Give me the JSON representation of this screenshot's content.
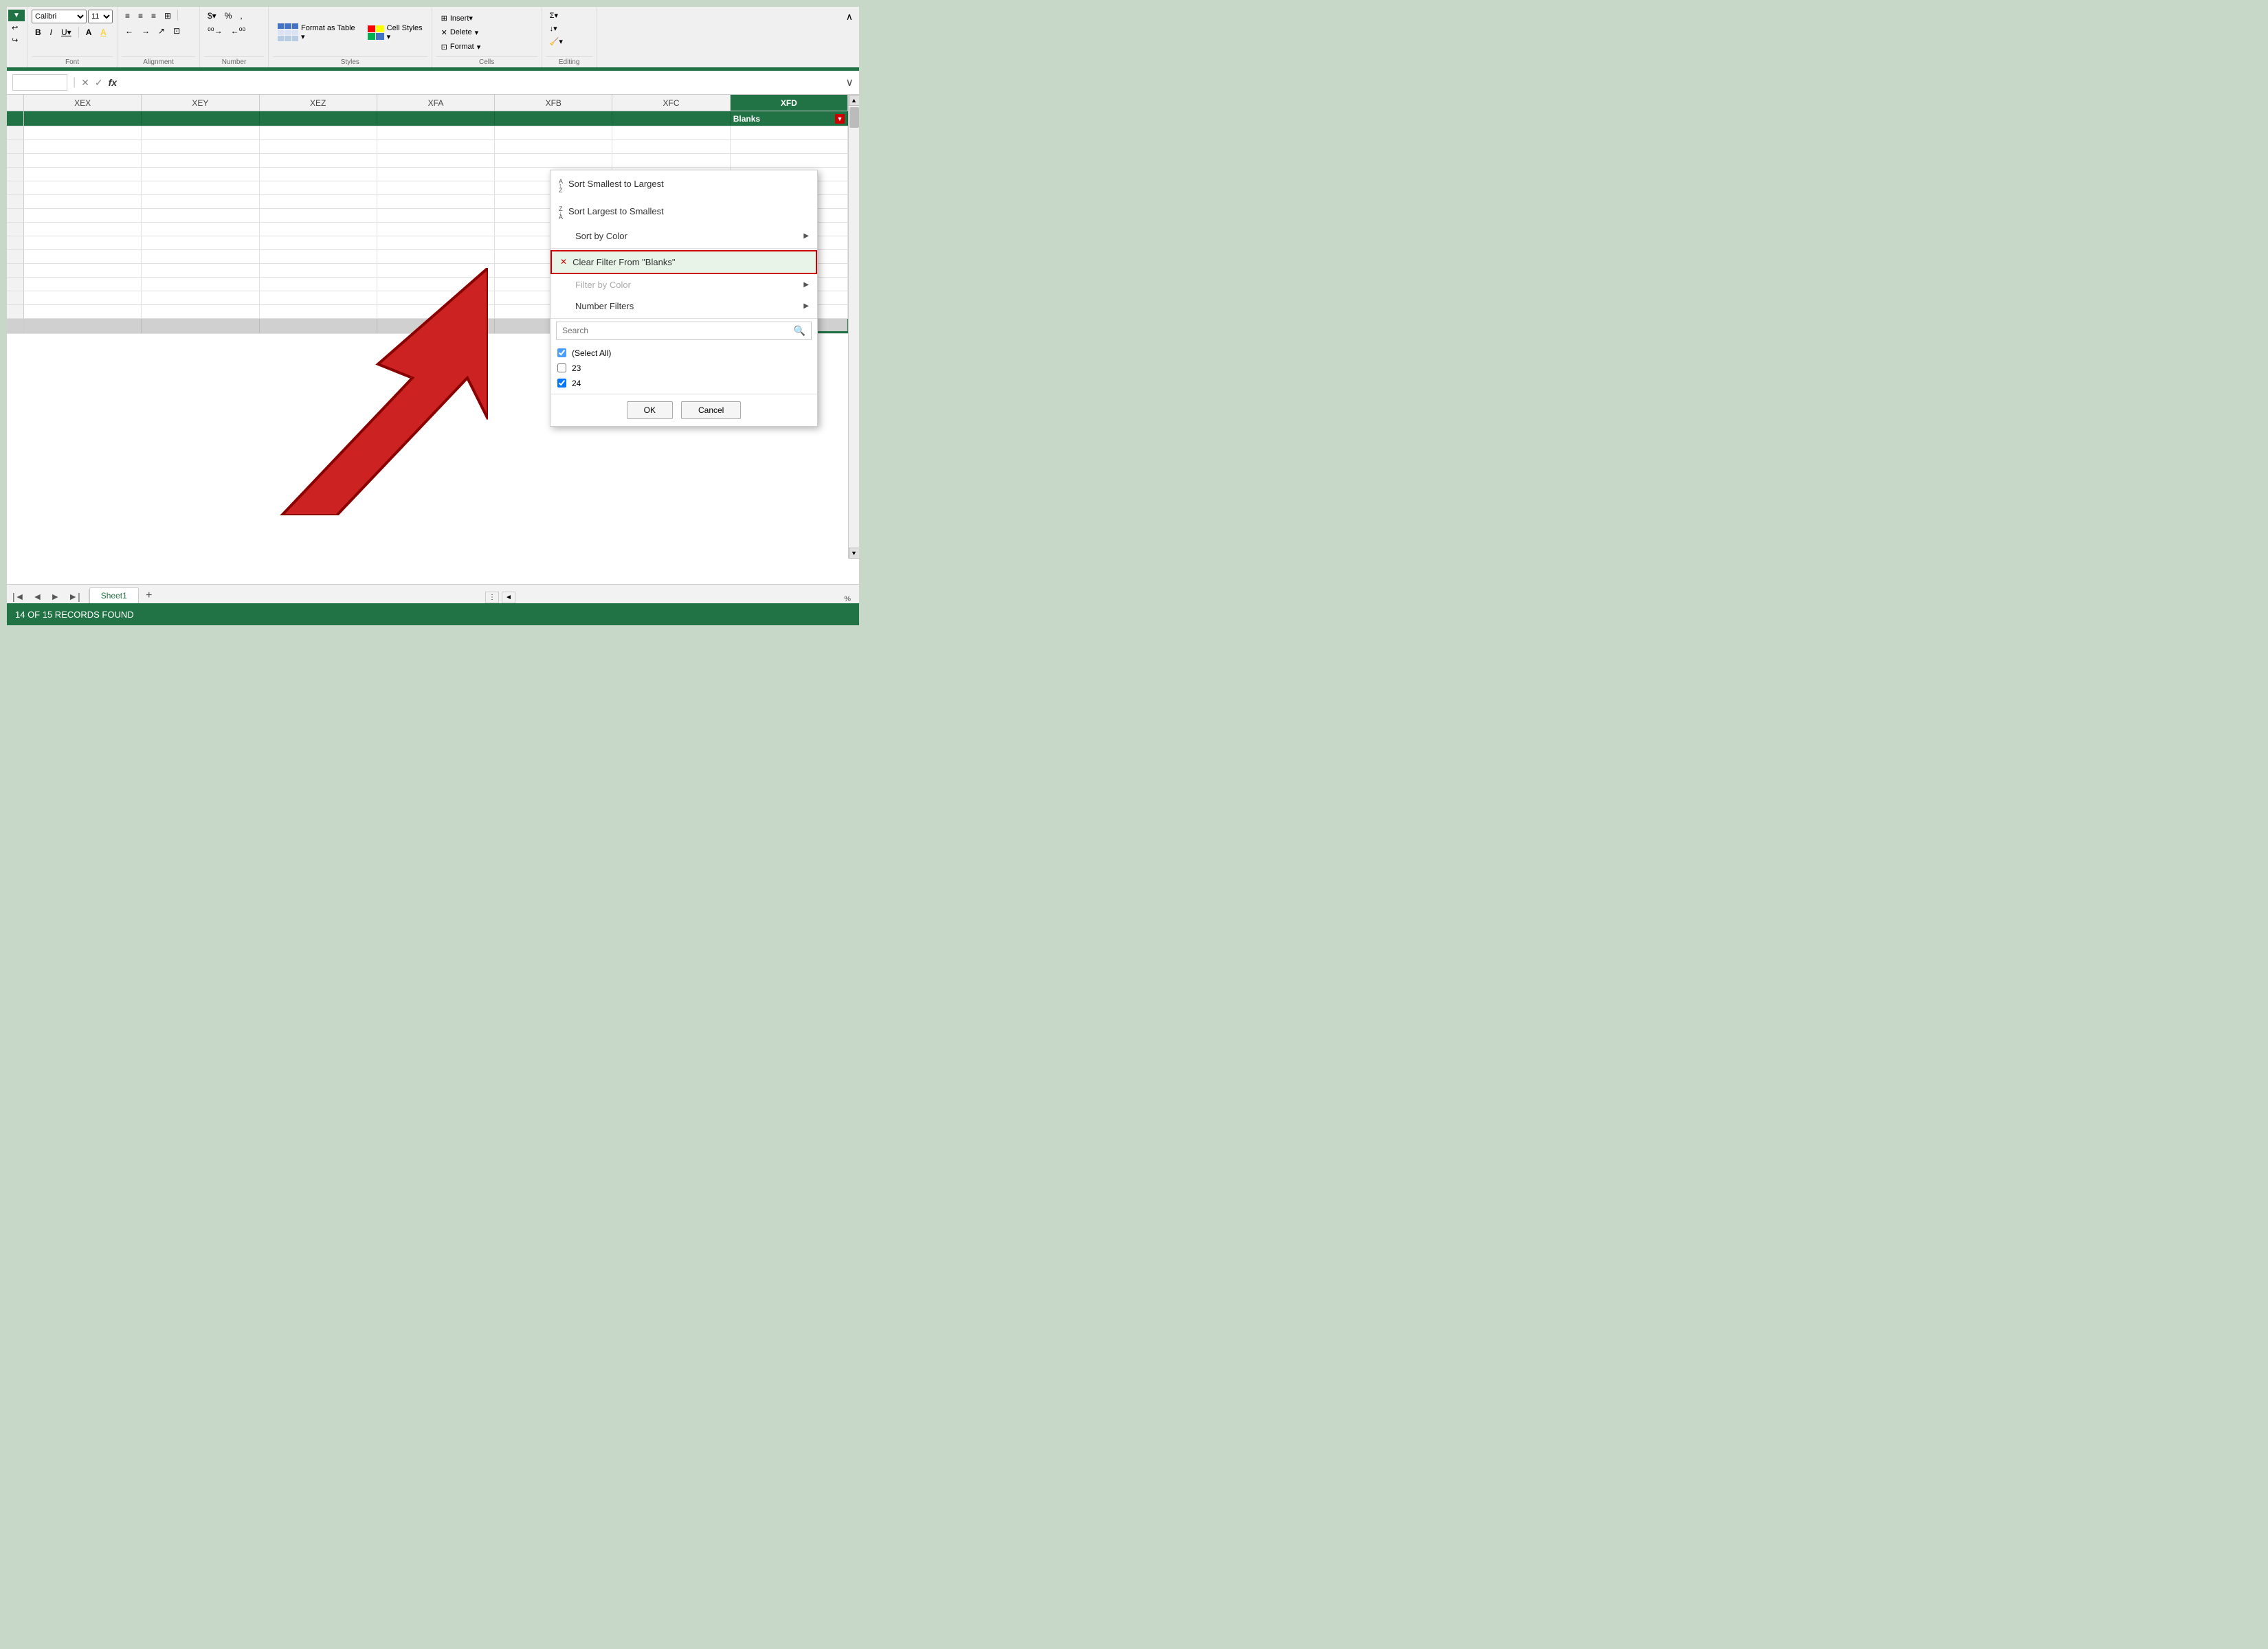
{
  "ribbon": {
    "sections": [
      {
        "name": "Font",
        "label": "Font",
        "buttons": [
          "B",
          "I",
          "U",
          "A",
          "A"
        ]
      },
      {
        "name": "Alignment",
        "label": "Alignment"
      },
      {
        "name": "Number",
        "label": "Number"
      },
      {
        "name": "Styles",
        "label": "Styles",
        "format_as_table": "Format as Table",
        "cell_styles": "Cell Styles"
      },
      {
        "name": "Cells",
        "label": "Cells",
        "delete": "Delete",
        "format": "Format"
      },
      {
        "name": "Editing",
        "label": "Editing"
      }
    ]
  },
  "formula_bar": {
    "name_box_value": "",
    "formula_value": ""
  },
  "columns": [
    "XEX",
    "XEY",
    "XEZ",
    "XFA",
    "XFB",
    "XFC",
    "XFD"
  ],
  "header_cell": {
    "label": "Blanks",
    "filter_active": true
  },
  "dropdown_menu": {
    "items": [
      {
        "id": "sort-asc",
        "label": "Sort Smallest to Largest",
        "icon": "↑",
        "disabled": false,
        "has_arrow": false
      },
      {
        "id": "sort-desc",
        "label": "Sort Largest to Smallest",
        "icon": "↓",
        "disabled": false,
        "has_arrow": false
      },
      {
        "id": "sort-color",
        "label": "Sort by Color",
        "icon": "",
        "disabled": false,
        "has_arrow": true
      },
      {
        "id": "clear-filter",
        "label": "Clear Filter From \"Blanks\"",
        "icon": "✕",
        "disabled": false,
        "highlighted": true,
        "has_arrow": false
      },
      {
        "id": "filter-color",
        "label": "Filter by Color",
        "icon": "",
        "disabled": true,
        "has_arrow": true
      },
      {
        "id": "number-filters",
        "label": "Number Filters",
        "icon": "",
        "disabled": false,
        "has_arrow": true
      }
    ],
    "search_placeholder": "Search",
    "checkbox_items": [
      {
        "id": "select-all",
        "label": "(Select All)",
        "checked": true,
        "indeterminate": true
      },
      {
        "id": "val-23",
        "label": "23",
        "checked": false
      },
      {
        "id": "val-24",
        "label": "24",
        "checked": true
      }
    ],
    "ok_label": "OK",
    "cancel_label": "Cancel"
  },
  "status_bar": {
    "text": "14 OF 15 RECORDS FOUND"
  },
  "sheet_tab": {
    "name": "Sheet1"
  },
  "zoom": {
    "value": "%"
  }
}
